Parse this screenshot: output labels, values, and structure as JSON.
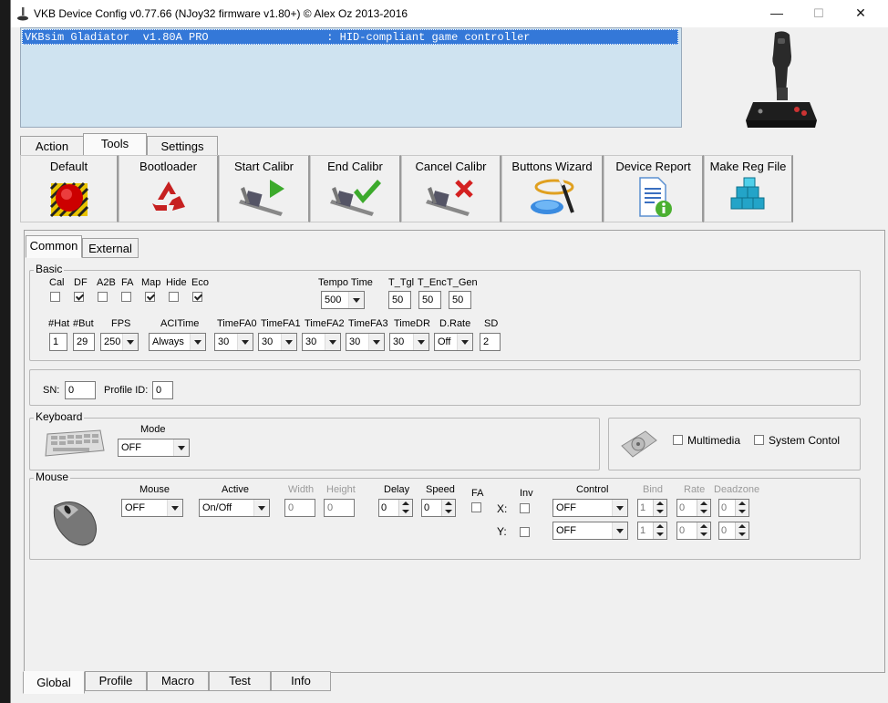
{
  "window": {
    "title": "VKB Device Config v0.77.66 (NJoy32 firmware v1.80+) © Alex Oz 2013-2016",
    "minimize": "—",
    "maximize": "☐",
    "close": "✕"
  },
  "devices": [
    {
      "text": "VKBsim Gladiator  v1.80A PRO                  : HID-compliant game controller"
    }
  ],
  "top_tabs": [
    "Action",
    "Tools",
    "Settings"
  ],
  "top_tabs_selected": "Tools",
  "toolbar": {
    "default": "Default",
    "bootloader": "Bootloader",
    "start_calibr": "Start Calibr",
    "end_calibr": "End Calibr",
    "cancel_calibr": "Cancel Calibr",
    "buttons_wizard": "Buttons Wizard",
    "device_report": "Device Report",
    "make_reg_file": "Make Reg File"
  },
  "sub_tabs": [
    "Common",
    "External"
  ],
  "sub_tabs_selected": "Common",
  "basic": {
    "title": "Basic",
    "flags": [
      {
        "label": "Cal",
        "checked": false
      },
      {
        "label": "DF",
        "checked": true
      },
      {
        "label": "A2B",
        "checked": false
      },
      {
        "label": "FA",
        "checked": false
      },
      {
        "label": "Map",
        "checked": true
      },
      {
        "label": "Hide",
        "checked": false
      },
      {
        "label": "Eco",
        "checked": true
      }
    ],
    "tempo_time_label": "Tempo Time",
    "tempo_time_value": "500",
    "t_tgl_label": "T_Tgl",
    "t_tgl_value": "50",
    "t_enc_label": "T_Enc",
    "t_enc_value": "50",
    "t_gen_label": "T_Gen",
    "t_gen_value": "50",
    "hat_label": "#Hat",
    "hat_value": "1",
    "but_label": "#But",
    "but_value": "29",
    "fps_label": "FPS",
    "fps_value": "250",
    "acltime_label": "ACITime",
    "acltime_value": "Always",
    "timefa0_label": "TimeFA0",
    "timefa0_value": "30",
    "timefa1_label": "TimeFA1",
    "timefa1_value": "30",
    "timefa2_label": "TimeFA2",
    "timefa2_value": "30",
    "timefa3_label": "TimeFA3",
    "timefa3_value": "30",
    "timedr_label": "TimeDR",
    "timedr_value": "30",
    "drate_label": "D.Rate",
    "drate_value": "Off",
    "sd_label": "SD",
    "sd_value": "2"
  },
  "ids": {
    "sn_label": "SN:",
    "sn_value": "0",
    "profile_id_label": "Profile ID:",
    "profile_id_value": "0"
  },
  "keyboard": {
    "title": "Keyboard",
    "mode_label": "Mode",
    "mode_value": "OFF"
  },
  "media": {
    "multimedia_label": "Multimedia",
    "multimedia_checked": false,
    "system_control_label": "System Contol",
    "system_control_checked": false
  },
  "mouse": {
    "title": "Mouse",
    "mouse_label": "Mouse",
    "mouse_value": "OFF",
    "active_label": "Active",
    "active_value": "On/Off",
    "width_label": "Width",
    "width_value": "0",
    "height_label": "Height",
    "height_value": "0",
    "delay_label": "Delay",
    "delay_value": "0",
    "speed_label": "Speed",
    "speed_value": "0",
    "fa_label": "FA",
    "inv_label": "Inv",
    "x_label": "X:",
    "y_label": "Y:",
    "control_label": "Control",
    "control_x_value": "OFF",
    "control_y_value": "OFF",
    "bind_label": "Bind",
    "bind_x_value": "1",
    "bind_y_value": "1",
    "rate_label": "Rate",
    "rate_x_value": "0",
    "rate_y_value": "0",
    "deadzone_label": "Deadzone",
    "deadzone_x_value": "0",
    "deadzone_y_value": "0"
  },
  "bottom_tabs": [
    "Global",
    "Profile",
    "Macro",
    "Test",
    "Info"
  ],
  "bottom_tabs_selected": "Global"
}
